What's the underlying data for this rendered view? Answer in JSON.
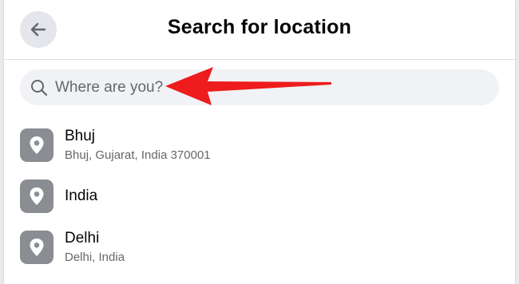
{
  "header": {
    "title": "Search for location",
    "back_icon": "arrow-left-icon"
  },
  "search": {
    "placeholder": "Where are you?",
    "value": "",
    "icon": "search-icon"
  },
  "locations": [
    {
      "name": "Bhuj",
      "detail": "Bhuj, Gujarat, India 370001",
      "icon": "location-pin-icon"
    },
    {
      "name": "India",
      "detail": "",
      "icon": "location-pin-icon"
    },
    {
      "name": "Delhi",
      "detail": "Delhi, India",
      "icon": "location-pin-icon"
    }
  ],
  "annotation": {
    "arrow_color": "#ee1c1c",
    "arrow_icon": "red-pointer-arrow"
  },
  "colors": {
    "title": "#050505",
    "secondary_text": "#65676b",
    "search_bg": "#f0f2f5",
    "pin_bg": "#8a8d91"
  }
}
